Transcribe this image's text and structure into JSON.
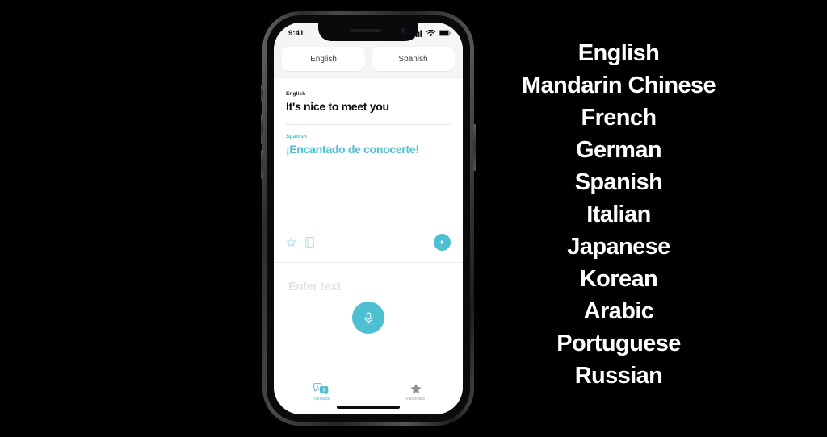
{
  "colors": {
    "accent_teal": "#4CBFD0",
    "background": "#000000",
    "screen_bg": "#FFFFFF",
    "status_bar_bg": "#F5F5F8",
    "placeholder_gray": "#E3E3E6",
    "inactive_tab_gray": "#9A9A9F"
  },
  "phone": {
    "status_bar": {
      "time": "9:41",
      "cellular_icon": "signal-bars-icon",
      "wifi_icon": "wifi-icon",
      "battery_icon": "battery-icon"
    },
    "language_selector": {
      "source_language": "English",
      "target_language": "Spanish"
    },
    "translation_card": {
      "source_label": "English",
      "source_text": "It's nice to meet you",
      "target_label": "Spanish",
      "target_text": "¡Encantado de conocerte!",
      "actions": {
        "favorite_icon": "star-outline-icon",
        "dictionary_icon": "book-icon",
        "play_icon": "play-circle-icon"
      }
    },
    "input_area": {
      "placeholder": "Enter text",
      "mic_icon": "microphone-icon"
    },
    "tab_bar": {
      "tabs": [
        {
          "label": "Translate",
          "icon": "translate-bubbles-icon",
          "active": true
        },
        {
          "label": "Favorites",
          "icon": "star-filled-icon",
          "active": false
        }
      ]
    }
  },
  "language_list": {
    "items": [
      "English",
      "Mandarin Chinese",
      "French",
      "German",
      "Spanish",
      "Italian",
      "Japanese",
      "Korean",
      "Arabic",
      "Portuguese",
      "Russian"
    ]
  }
}
